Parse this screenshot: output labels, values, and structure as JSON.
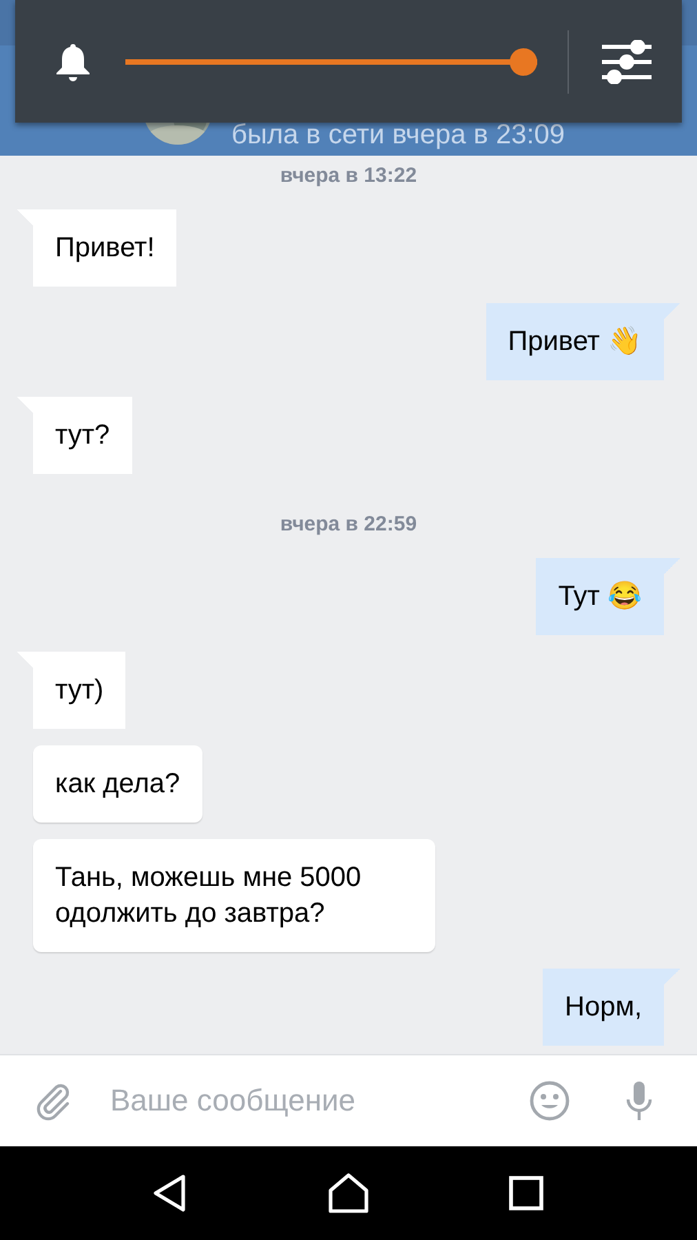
{
  "header": {
    "status": "была в сети вчера в 23:09"
  },
  "volume_overlay": {
    "level": 1.0
  },
  "messages": [
    {
      "kind": "date",
      "text": "вчера в 13:22"
    },
    {
      "kind": "in",
      "text": "Привет!"
    },
    {
      "kind": "out",
      "text": "Привет 👋"
    },
    {
      "kind": "in",
      "text": "тут?"
    },
    {
      "kind": "date",
      "text": "вчера в 22:59"
    },
    {
      "kind": "out",
      "text": "Тут 😂"
    },
    {
      "kind": "in",
      "text": "тут)"
    },
    {
      "kind": "in",
      "text": "как дела?"
    },
    {
      "kind": "in",
      "text": "Тань, можешь мне 5000 одолжить до завтра?"
    },
    {
      "kind": "out",
      "text": "Норм,"
    }
  ],
  "composer": {
    "placeholder": "Ваше сообщение"
  }
}
